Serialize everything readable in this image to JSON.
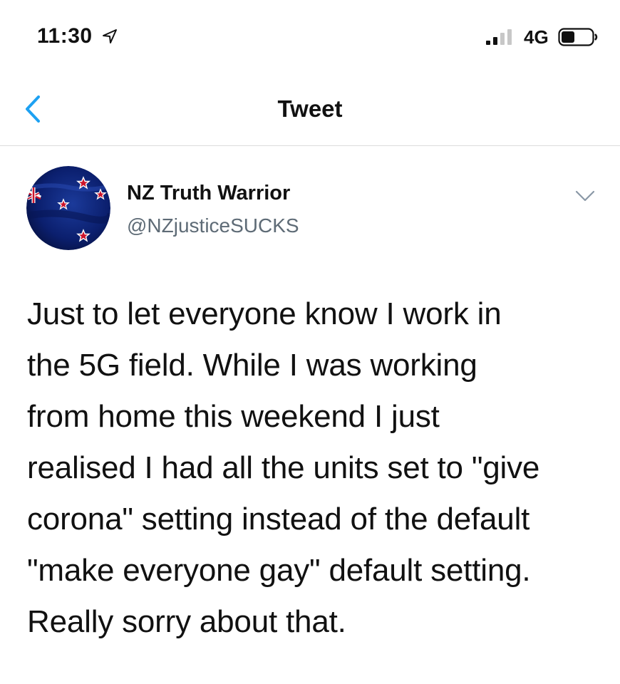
{
  "status_bar": {
    "time": "11:30",
    "network": "4G",
    "icons": [
      "location-arrow-icon",
      "cellular-signal-icon",
      "battery-icon"
    ]
  },
  "nav": {
    "title": "Tweet",
    "back_icon": "chevron-left-icon"
  },
  "tweet": {
    "author": {
      "display_name": "NZ Truth Warrior",
      "handle": "@NZjusticeSUCKS",
      "avatar": "new-zealand-flag-avatar"
    },
    "more_icon": "chevron-down-icon",
    "text_lines": [
      "Just to let everyone know I work in",
      "the 5G field.  While I was working",
      "from home this weekend I just",
      "realised I had all the units set to \"give",
      "corona\" setting instead of the default",
      "\"make everyone gay\" default setting.",
      "Really sorry about that."
    ]
  },
  "colors": {
    "accent": "#1da1f2",
    "text": "#111111",
    "secondary_text": "#5e6b76",
    "divider": "#dcdcdc",
    "flag_blue": "#0b1f6e",
    "flag_red": "#cc142b"
  }
}
